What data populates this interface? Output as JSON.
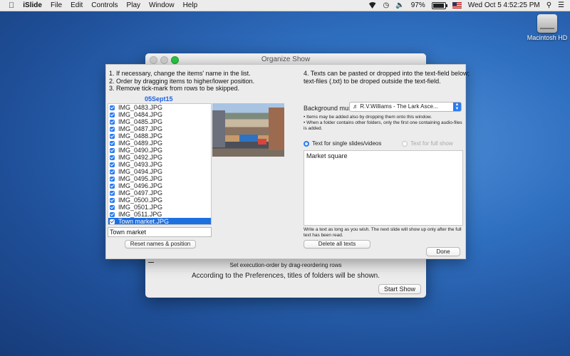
{
  "menubar": {
    "apple": "",
    "app": "iSlide",
    "items": [
      "File",
      "Edit",
      "Controls",
      "Play",
      "Window",
      "Help"
    ],
    "battery": "97%",
    "datetime": "Wed Oct 5  4:52:25 PM"
  },
  "desktop": {
    "hd_label": "Macintosh HD"
  },
  "back_window": {
    "title": "Organize Show",
    "dash": "—",
    "order_label": "Set execution-order by drag-reordering rows",
    "prefs_text": "According to the Preferences, titles of folders will be shown.",
    "start_button": "Start Show"
  },
  "panel": {
    "instructions_left": [
      "1. If necessary, change the items' name in the list.",
      "2. Order by dragging items to higher/lower position.",
      "3. Remove tick-mark from rows to be skipped."
    ],
    "instructions_right": [
      "4. Texts can be pasted or dropped into the text-field below;",
      "text-files (.txt) to be droped outside the text-field."
    ],
    "folder_name": "05Sept15",
    "files": [
      {
        "name": "IMG_0483.JPG",
        "checked": true
      },
      {
        "name": "IMG_0484.JPG",
        "checked": true
      },
      {
        "name": "IMG_0485.JPG",
        "checked": true
      },
      {
        "name": "IMG_0487.JPG",
        "checked": true
      },
      {
        "name": "IMG_0488.JPG",
        "checked": true
      },
      {
        "name": "IMG_0489.JPG",
        "checked": true
      },
      {
        "name": "IMG_0490.JPG",
        "checked": true
      },
      {
        "name": "IMG_0492.JPG",
        "checked": true
      },
      {
        "name": "IMG_0493.JPG",
        "checked": true
      },
      {
        "name": "IMG_0494.JPG",
        "checked": true
      },
      {
        "name": "IMG_0495.JPG",
        "checked": true
      },
      {
        "name": "IMG_0496.JPG",
        "checked": true
      },
      {
        "name": "IMG_0497.JPG",
        "checked": true
      },
      {
        "name": "IMG_0500.JPG",
        "checked": true
      },
      {
        "name": "IMG_0501.JPG",
        "checked": true
      },
      {
        "name": "IMG_0511.JPG",
        "checked": true
      },
      {
        "name": "Town market.JPG",
        "checked": true,
        "selected": true
      }
    ],
    "name_field_value": "Town market",
    "reset_button": "Reset names & position",
    "bgm_label": "Background music:",
    "bgm_value": "♬  R.V.Williams - The Lark Asce...",
    "notes": [
      "• Items may be added also by dropping them onto this window.",
      "• When a folder contains other folders, only the first one containing audio-files is added."
    ],
    "radio_single": "Text for single slides/videos",
    "radio_full": "Text for full show",
    "text_content": "Market square",
    "note2": "Write a text as long as you wish. The next slide will show up only after the full text has been read.",
    "delete_button": "Delete all texts",
    "done_button": "Done"
  }
}
